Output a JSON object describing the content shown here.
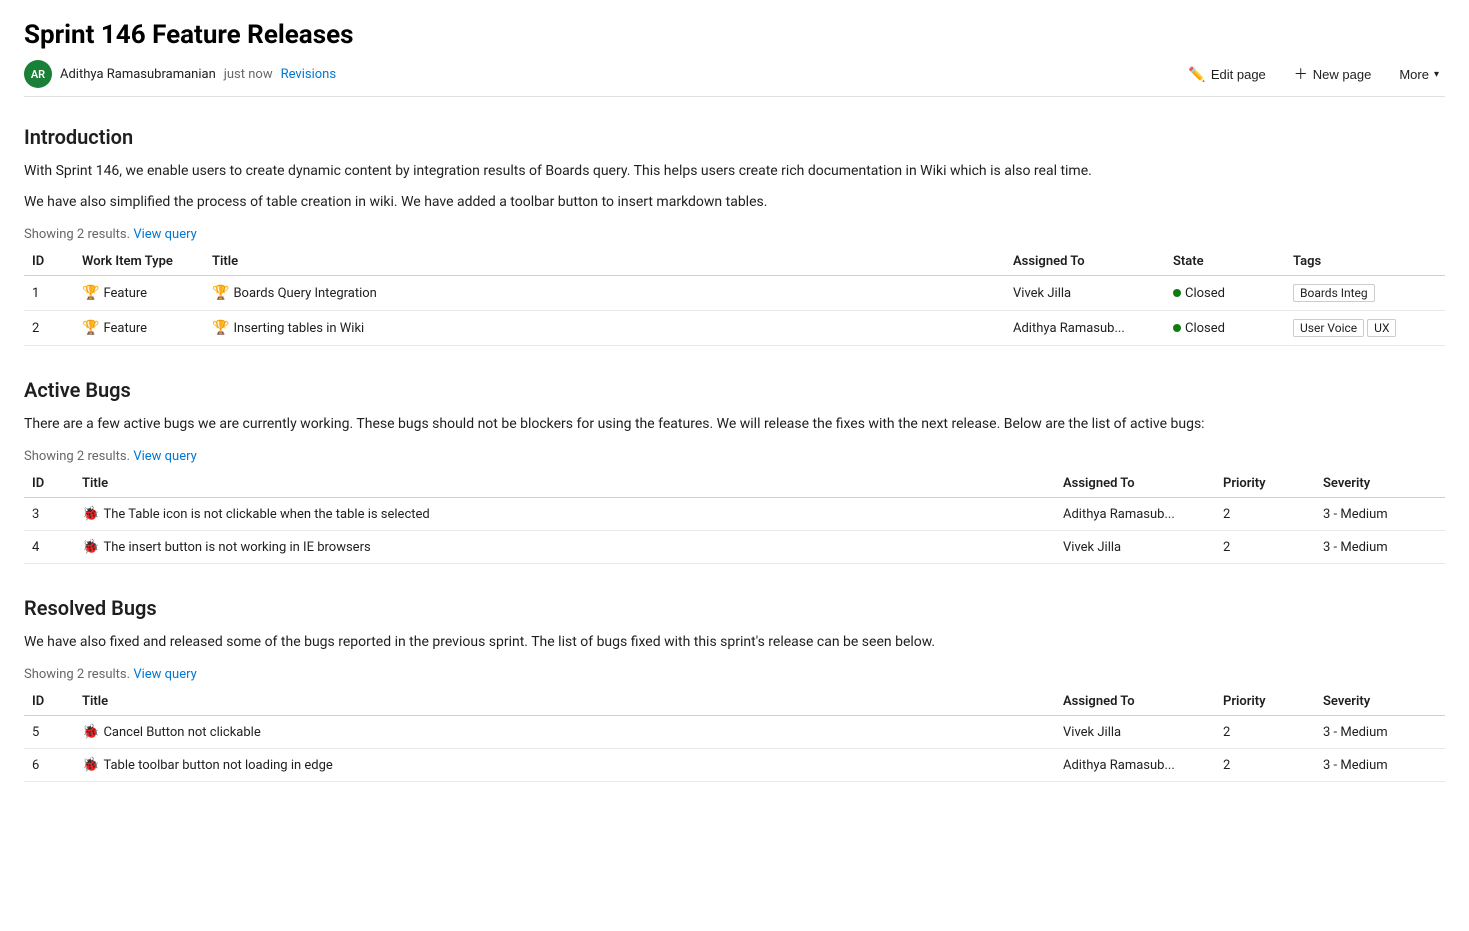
{
  "page": {
    "title": "Sprint 146 Feature Releases",
    "author_initials": "AR",
    "author_name": "Adithya Ramasubramanian",
    "timestamp": "just now",
    "revisions_label": "Revisions",
    "toolbar": {
      "edit_label": "Edit page",
      "new_label": "New page",
      "more_label": "More"
    }
  },
  "introduction": {
    "heading": "Introduction",
    "paragraphs": [
      "With Sprint 146, we enable users to create dynamic content by integration results of Boards query. This helps users create rich documentation in Wiki which is also real time.",
      "We have also simplified the process of table creation in wiki. We have added a toolbar button to insert markdown tables."
    ],
    "showing_results": "Showing 2 results.",
    "view_query_label": "View query",
    "table": {
      "columns": [
        "ID",
        "Work Item Type",
        "Title",
        "Assigned To",
        "State",
        "Tags"
      ],
      "rows": [
        {
          "id": "1",
          "type": "Feature",
          "type_icon": "trophy",
          "title": "Boards Query Integration",
          "assigned_to": "Vivek Jilla",
          "state": "Closed",
          "tags": [
            "Boards Integ"
          ]
        },
        {
          "id": "2",
          "type": "Feature",
          "type_icon": "trophy",
          "title": "Inserting tables in Wiki",
          "assigned_to": "Adithya Ramasub...",
          "state": "Closed",
          "tags": [
            "User Voice",
            "UX"
          ]
        }
      ]
    }
  },
  "active_bugs": {
    "heading": "Active Bugs",
    "paragraph": "There are a few active bugs we are currently working. These bugs should not be blockers for using the features. We will release the fixes with the next release. Below are the list of active bugs:",
    "showing_results": "Showing 2 results.",
    "view_query_label": "View query",
    "table": {
      "columns": [
        "ID",
        "Title",
        "Assigned To",
        "Priority",
        "Severity"
      ],
      "rows": [
        {
          "id": "3",
          "title": "The Table icon is not clickable when the table is selected",
          "assigned_to": "Adithya Ramasub...",
          "priority": "2",
          "severity": "3 - Medium"
        },
        {
          "id": "4",
          "title": "The insert button is not working in IE browsers",
          "assigned_to": "Vivek Jilla",
          "priority": "2",
          "severity": "3 - Medium"
        }
      ]
    }
  },
  "resolved_bugs": {
    "heading": "Resolved Bugs",
    "paragraph": "We have also fixed and released some of the bugs reported in the previous sprint. The list of bugs fixed with this sprint's release can be seen below.",
    "showing_results": "Showing 2 results.",
    "view_query_label": "View query",
    "table": {
      "columns": [
        "ID",
        "Title",
        "Assigned To",
        "Priority",
        "Severity"
      ],
      "rows": [
        {
          "id": "5",
          "title": "Cancel Button not clickable",
          "assigned_to": "Vivek Jilla",
          "priority": "2",
          "severity": "3 - Medium"
        },
        {
          "id": "6",
          "title": "Table toolbar button not loading in edge",
          "assigned_to": "Adithya Ramasub...",
          "priority": "2",
          "severity": "3 - Medium"
        }
      ]
    }
  }
}
